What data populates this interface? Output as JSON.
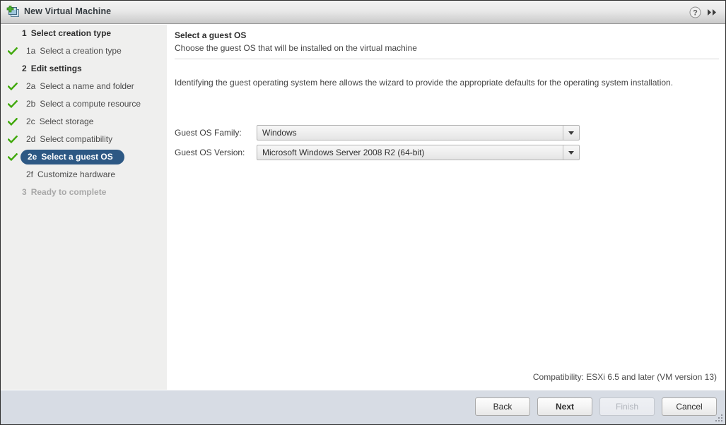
{
  "window": {
    "title": "New Virtual Machine",
    "icon": "new-virtual-machine-icon",
    "help_icon": "help-icon",
    "collapse_icon": "double-chevron-right-icon"
  },
  "sidebar": {
    "items": [
      {
        "num": "1",
        "label": "Select creation type",
        "type": "section",
        "checked": false,
        "selected": false,
        "disabled": false
      },
      {
        "num": "1a",
        "label": "Select a creation type",
        "type": "sub",
        "checked": true,
        "selected": false,
        "disabled": false
      },
      {
        "num": "2",
        "label": "Edit settings",
        "type": "section",
        "checked": false,
        "selected": false,
        "disabled": false
      },
      {
        "num": "2a",
        "label": "Select a name and folder",
        "type": "sub",
        "checked": true,
        "selected": false,
        "disabled": false
      },
      {
        "num": "2b",
        "label": "Select a compute resource",
        "type": "sub",
        "checked": true,
        "selected": false,
        "disabled": false
      },
      {
        "num": "2c",
        "label": "Select storage",
        "type": "sub",
        "checked": true,
        "selected": false,
        "disabled": false
      },
      {
        "num": "2d",
        "label": "Select compatibility",
        "type": "sub",
        "checked": true,
        "selected": false,
        "disabled": false
      },
      {
        "num": "2e",
        "label": "Select a guest OS",
        "type": "sub",
        "checked": true,
        "selected": true,
        "disabled": false
      },
      {
        "num": "2f",
        "label": "Customize hardware",
        "type": "sub",
        "checked": false,
        "selected": false,
        "disabled": false
      },
      {
        "num": "3",
        "label": "Ready to complete",
        "type": "section",
        "checked": false,
        "selected": false,
        "disabled": true
      }
    ]
  },
  "content": {
    "title": "Select a guest OS",
    "subtitle": "Choose the guest OS that will be installed on the virtual machine",
    "paragraph": "Identifying the guest operating system here allows the wizard to provide the appropriate defaults for the operating system installation.",
    "fields": [
      {
        "label": "Guest OS Family:",
        "value": "Windows"
      },
      {
        "label": "Guest OS Version:",
        "value": "Microsoft Windows Server 2008 R2 (64-bit)"
      }
    ],
    "compatibility": "Compatibility: ESXi 6.5 and later (VM version 13)"
  },
  "footer": {
    "buttons": [
      {
        "label": "Back",
        "state": "normal"
      },
      {
        "label": "Next",
        "state": "primary"
      },
      {
        "label": "Finish",
        "state": "disabled"
      },
      {
        "label": "Cancel",
        "state": "normal"
      }
    ]
  },
  "colors": {
    "selected_nav": "#2d5884",
    "check_green": "#3fa80a",
    "sidebar_bg": "#efefee",
    "footer_bg": "#d7dce4"
  }
}
